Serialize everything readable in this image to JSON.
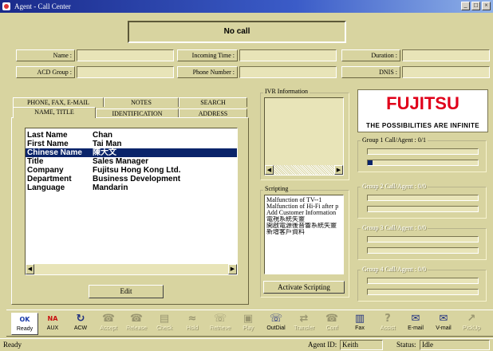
{
  "window": {
    "title": "Agent - Call Center"
  },
  "call": {
    "status": "No call"
  },
  "fields": {
    "name": {
      "label": "Name :",
      "value": ""
    },
    "incoming_time": {
      "label": "Incoming Time :",
      "value": ""
    },
    "duration": {
      "label": "Duration :",
      "value": ""
    },
    "acd_group": {
      "label": "ACD Group :",
      "value": ""
    },
    "phone_number": {
      "label": "Phone Number :",
      "value": ""
    },
    "dnis": {
      "label": "DNIS :",
      "value": ""
    }
  },
  "tabs": {
    "row1": [
      "PHONE, FAX, E-MAIL",
      "NOTES",
      "SEARCH"
    ],
    "row2": [
      "NAME, TITLE",
      "IDENTIFICATION",
      "ADDRESS"
    ]
  },
  "contact": {
    "rows": [
      {
        "key": "Last Name",
        "value": "Chan"
      },
      {
        "key": "First Name",
        "value": "Tai Man"
      },
      {
        "key": "Chinese Name",
        "value": "陳大文"
      },
      {
        "key": "Title",
        "value": "Sales Manager"
      },
      {
        "key": "Company",
        "value": "Fujitsu Hong Kong Ltd."
      },
      {
        "key": "Department",
        "value": "Business Development"
      },
      {
        "key": "Language",
        "value": "Mandarin"
      }
    ],
    "selected_index": 2
  },
  "edit_button": "Edit",
  "ivr": {
    "title": "IVR Information"
  },
  "scripting": {
    "title": "Scripting",
    "items": [
      "Malfunction of TV--1",
      "Malfunction of Hi-Fi after p",
      "Add Customer Information",
      "電視系統失靈",
      "開啟電源後音響系統失靈",
      "新增客戶資料"
    ],
    "activate_label": "Activate Scripting"
  },
  "logo": {
    "brand": "FUJITSU",
    "tagline": "THE POSSIBILITIES ARE INFINITE",
    "brand_color": "#e0001a"
  },
  "groups": [
    {
      "title": "Group 1 Call/Agent : 0/1"
    },
    {
      "title": "Group 2 Call/Agent : 0/0"
    },
    {
      "title": "Group 3 Call/Agent : 0/0"
    },
    {
      "title": "Group 4 Call/Agent : 0/0"
    }
  ],
  "toolbar": [
    {
      "id": "ready",
      "icon": "ok-icon",
      "glyph": "OK",
      "label": "Ready",
      "enabled": true
    },
    {
      "id": "aux",
      "icon": "na-icon",
      "glyph": "NA",
      "label": "AUX",
      "enabled": true
    },
    {
      "id": "acw",
      "icon": "acw-icon",
      "glyph": "↻",
      "label": "ACW",
      "enabled": true
    },
    {
      "id": "accept",
      "icon": "phone-accept-icon",
      "glyph": "☎",
      "label": "Accept",
      "enabled": false
    },
    {
      "id": "release",
      "icon": "phone-release-icon",
      "glyph": "☎",
      "label": "Release",
      "enabled": false
    },
    {
      "id": "check",
      "icon": "check-icon",
      "glyph": "▤",
      "label": "Check",
      "enabled": false
    },
    {
      "id": "hold",
      "icon": "hold-icon",
      "glyph": "≈",
      "label": "Hold",
      "enabled": false
    },
    {
      "id": "retrieve",
      "icon": "retrieve-icon",
      "glyph": "☏",
      "label": "Retrieve",
      "enabled": false
    },
    {
      "id": "play",
      "icon": "play-icon",
      "glyph": "▣",
      "label": "Play",
      "enabled": false
    },
    {
      "id": "outdial",
      "icon": "outdial-icon",
      "glyph": "☏",
      "label": "OutDial",
      "enabled": true
    },
    {
      "id": "transfer",
      "icon": "transfer-icon",
      "glyph": "⇄",
      "label": "Transfer",
      "enabled": false
    },
    {
      "id": "conf",
      "icon": "conference-icon",
      "glyph": "☎",
      "label": "Conf",
      "enabled": false
    },
    {
      "id": "fax",
      "icon": "fax-icon",
      "glyph": "▥",
      "label": "Fax",
      "enabled": true
    },
    {
      "id": "assist",
      "icon": "assist-icon",
      "glyph": "?",
      "label": "Assist",
      "enabled": false
    },
    {
      "id": "email",
      "icon": "email-icon",
      "glyph": "✉",
      "label": "E-mail",
      "enabled": true
    },
    {
      "id": "vmail",
      "icon": "vmail-icon",
      "glyph": "✉",
      "label": "V-mail",
      "enabled": true
    },
    {
      "id": "pickup",
      "icon": "pickup-icon",
      "glyph": "↗",
      "label": "PickUp",
      "enabled": false
    }
  ],
  "status": {
    "left": "Ready",
    "agent_label": "Agent ID:",
    "agent_id": "Keith",
    "status_label": "Status:",
    "status_value": "Idle"
  },
  "colors": {
    "background": "#d8d4a0",
    "selection": "#0a246a",
    "titlebar": "#1a2a8a"
  }
}
